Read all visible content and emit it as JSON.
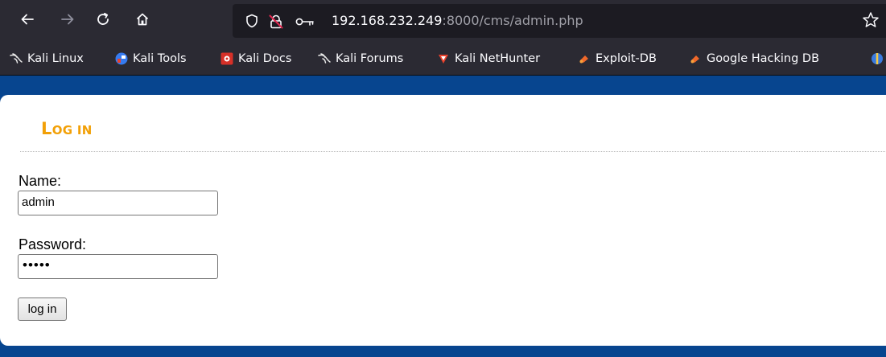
{
  "browser": {
    "url_host": "192.168.232.249",
    "url_path": ":8000/cms/admin.php"
  },
  "bookmarks": [
    {
      "label": "Kali Linux",
      "icon": "kali-dragon-icon"
    },
    {
      "label": "Kali Tools",
      "icon": "kali-tools-icon"
    },
    {
      "label": "Kali Docs",
      "icon": "kali-docs-icon"
    },
    {
      "label": "Kali Forums",
      "icon": "kali-dragon-icon"
    },
    {
      "label": "Kali NetHunter",
      "icon": "nethunter-icon"
    },
    {
      "label": "Exploit-DB",
      "icon": "exploit-db-icon"
    },
    {
      "label": "Google Hacking DB",
      "icon": "exploit-db-icon"
    },
    {
      "label": "",
      "icon": "offsec-icon"
    }
  ],
  "page": {
    "heading_first": "L",
    "heading_rest": "OG IN",
    "name_label": "Name:",
    "name_value": "admin",
    "password_label": "Password:",
    "password_value": "•••••",
    "submit_label": "log in"
  },
  "colors": {
    "page_background": "#07458f",
    "heading": "#f2a007",
    "toolbar": "#2b2a33"
  }
}
